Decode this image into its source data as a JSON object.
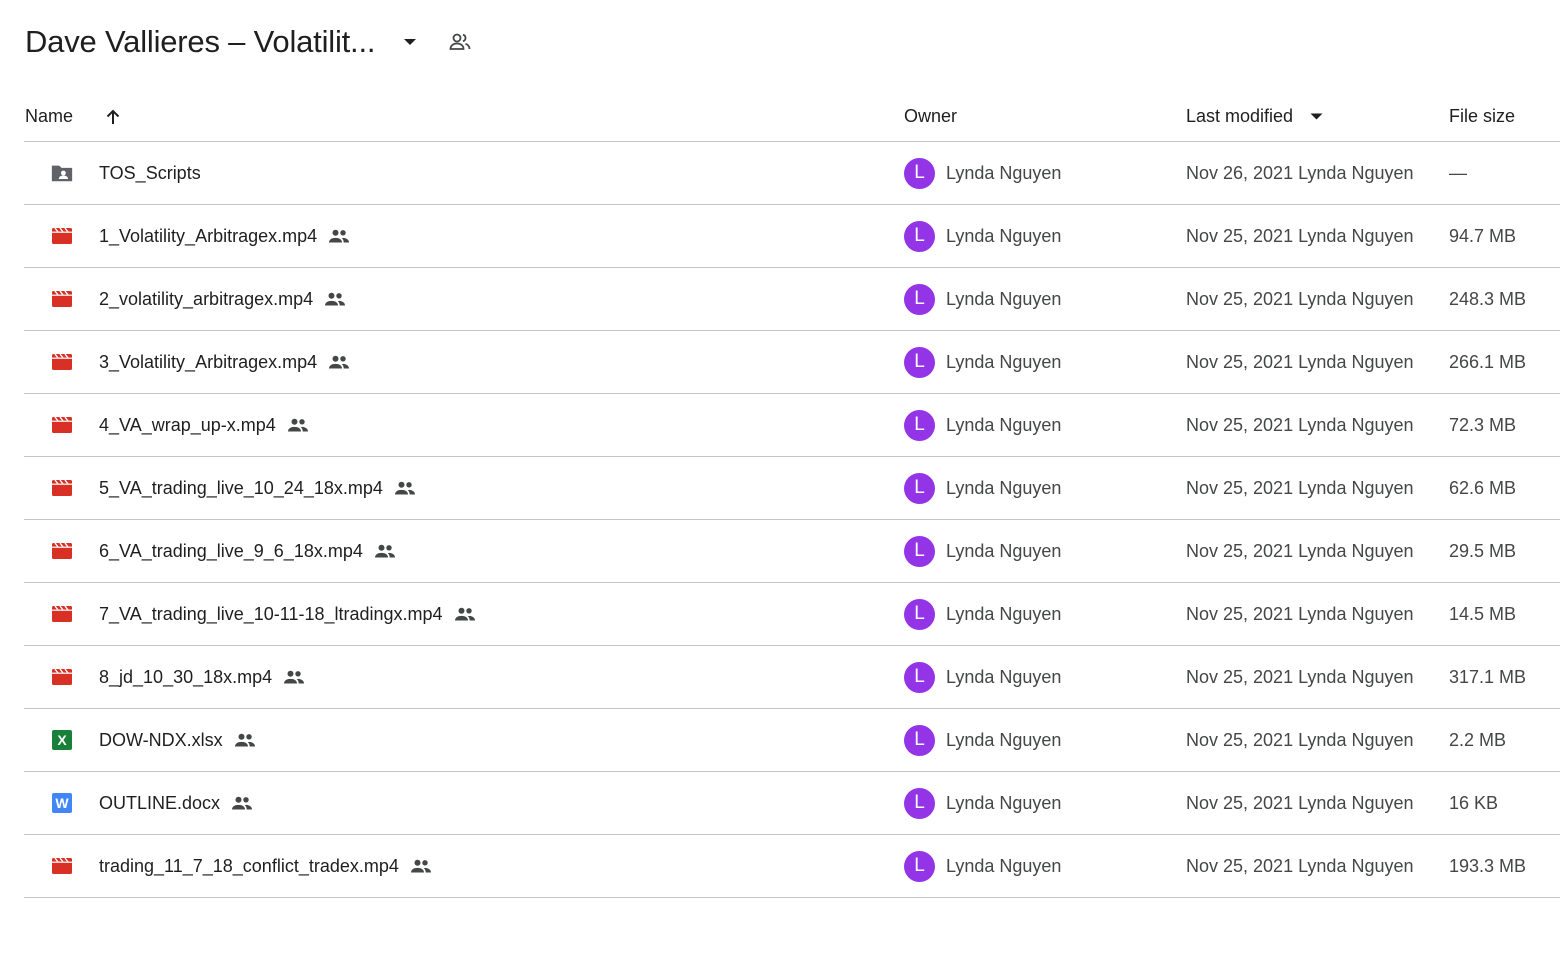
{
  "folder": {
    "title": "Dave Vallieres – Volatilit..."
  },
  "columns": {
    "name": "Name",
    "owner": "Owner",
    "last_modified": "Last modified",
    "file_size": "File size"
  },
  "colors": {
    "avatar": "#9334e6",
    "video": "#d93025",
    "xlsx": "#188038",
    "docx": "#4285f4",
    "folder": "#5f6368"
  },
  "files": [
    {
      "name": "TOS_Scripts",
      "type": "shared-folder-icon",
      "shared": false,
      "owner_initial": "L",
      "owner": "Lynda Nguyen",
      "modified": "Nov 26, 2021 Lynda Nguyen",
      "size": "—"
    },
    {
      "name": "1_Volatility_Arbitragex.mp4",
      "type": "video-file-icon",
      "shared": true,
      "owner_initial": "L",
      "owner": "Lynda Nguyen",
      "modified": "Nov 25, 2021 Lynda Nguyen",
      "size": "94.7 MB"
    },
    {
      "name": "2_volatility_arbitragex.mp4",
      "type": "video-file-icon",
      "shared": true,
      "owner_initial": "L",
      "owner": "Lynda Nguyen",
      "modified": "Nov 25, 2021 Lynda Nguyen",
      "size": "248.3 MB"
    },
    {
      "name": "3_Volatility_Arbitragex.mp4",
      "type": "video-file-icon",
      "shared": true,
      "owner_initial": "L",
      "owner": "Lynda Nguyen",
      "modified": "Nov 25, 2021 Lynda Nguyen",
      "size": "266.1 MB"
    },
    {
      "name": "4_VA_wrap_up-x.mp4",
      "type": "video-file-icon",
      "shared": true,
      "owner_initial": "L",
      "owner": "Lynda Nguyen",
      "modified": "Nov 25, 2021 Lynda Nguyen",
      "size": "72.3 MB"
    },
    {
      "name": "5_VA_trading_live_10_24_18x.mp4",
      "type": "video-file-icon",
      "shared": true,
      "owner_initial": "L",
      "owner": "Lynda Nguyen",
      "modified": "Nov 25, 2021 Lynda Nguyen",
      "size": "62.6 MB"
    },
    {
      "name": "6_VA_trading_live_9_6_18x.mp4",
      "type": "video-file-icon",
      "shared": true,
      "owner_initial": "L",
      "owner": "Lynda Nguyen",
      "modified": "Nov 25, 2021 Lynda Nguyen",
      "size": "29.5 MB"
    },
    {
      "name": "7_VA_trading_live_10-11-18_ltradingx.mp4",
      "type": "video-file-icon",
      "shared": true,
      "owner_initial": "L",
      "owner": "Lynda Nguyen",
      "modified": "Nov 25, 2021 Lynda Nguyen",
      "size": "14.5 MB"
    },
    {
      "name": "8_jd_10_30_18x.mp4",
      "type": "video-file-icon",
      "shared": true,
      "owner_initial": "L",
      "owner": "Lynda Nguyen",
      "modified": "Nov 25, 2021 Lynda Nguyen",
      "size": "317.1 MB"
    },
    {
      "name": "DOW-NDX.xlsx",
      "type": "excel-file-icon",
      "shared": true,
      "owner_initial": "L",
      "owner": "Lynda Nguyen",
      "modified": "Nov 25, 2021 Lynda Nguyen",
      "size": "2.2 MB"
    },
    {
      "name": "OUTLINE.docx",
      "type": "word-file-icon",
      "shared": true,
      "owner_initial": "L",
      "owner": "Lynda Nguyen",
      "modified": "Nov 25, 2021 Lynda Nguyen",
      "size": "16 KB"
    },
    {
      "name": "trading_11_7_18_conflict_tradex.mp4",
      "type": "video-file-icon",
      "shared": true,
      "owner_initial": "L",
      "owner": "Lynda Nguyen",
      "modified": "Nov 25, 2021 Lynda Nguyen",
      "size": "193.3 MB"
    }
  ],
  "icon_glyphs": {
    "xlsx": "X",
    "docx": "W"
  }
}
